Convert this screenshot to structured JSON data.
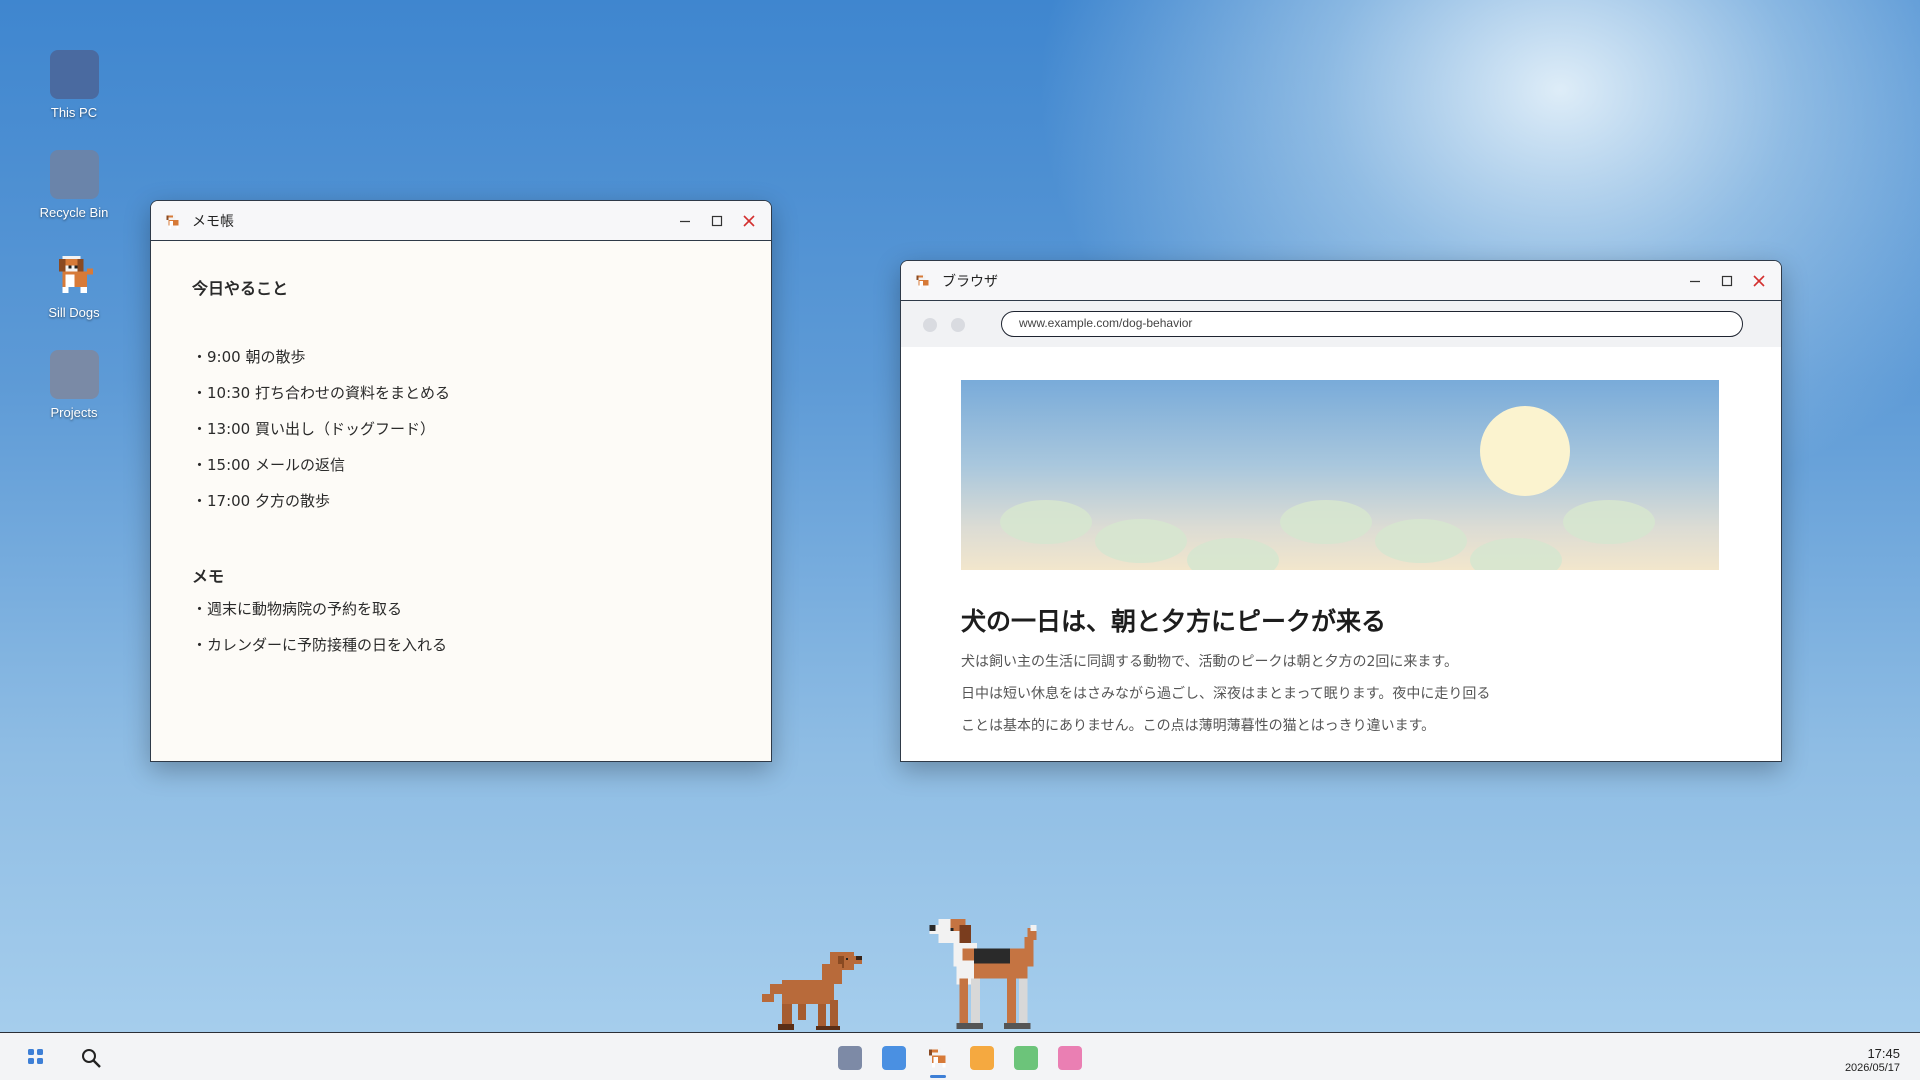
{
  "desktop": {
    "icons": [
      {
        "label": "This PC",
        "color": "#4a6aa0"
      },
      {
        "label": "Recycle Bin",
        "color": "#6a84aa"
      },
      {
        "label": "Sill Dogs",
        "icon": "beagle-dog-icon"
      },
      {
        "label": "Projects",
        "color": "#7a8aa6"
      }
    ]
  },
  "notepad": {
    "title": "メモ帳",
    "heading1": "今日やること",
    "todos": [
      "・9:00  朝の散歩",
      "・10:30 打ち合わせの資料をまとめる",
      "・13:00 買い出し（ドッグフード）",
      "・15:00 メールの返信",
      "・17:00 夕方の散歩"
    ],
    "heading2": "メモ",
    "memos": [
      "・週末に動物病院の予約を取る",
      "・カレンダーに予防接種の日を入れる"
    ]
  },
  "browser": {
    "title": "ブラウザ",
    "url": "www.example.com/dog-behavior",
    "article_title": "犬の一日は、朝と夕方にピークが来る",
    "paragraph_lines": [
      "犬は飼い主の生活に同調する動物で、活動のピークは朝と夕方の2回に来ます。",
      "日中は短い休息をはさみながら過ごし、深夜はまとまって眠ります。夜中に走り回る",
      "ことは基本的にありません。この点は薄明薄暮性の猫とはっきり違います。"
    ]
  },
  "taskbar": {
    "pinned": [
      {
        "name": "gray-app",
        "color": "#7d8aa6"
      },
      {
        "name": "blue-app",
        "color": "#4a90e2"
      },
      {
        "name": "sill-dogs-app",
        "icon": "beagle-dog-icon",
        "active": true
      },
      {
        "name": "orange-app",
        "color": "#f5a940"
      },
      {
        "name": "green-app",
        "color": "#6cc47a"
      },
      {
        "name": "pink-app",
        "color": "#ea7fb3"
      }
    ],
    "time": "17:45",
    "date": "2026/05/17"
  },
  "colors": {
    "close": "#d32f2f",
    "accent": "#3d7fd6"
  }
}
